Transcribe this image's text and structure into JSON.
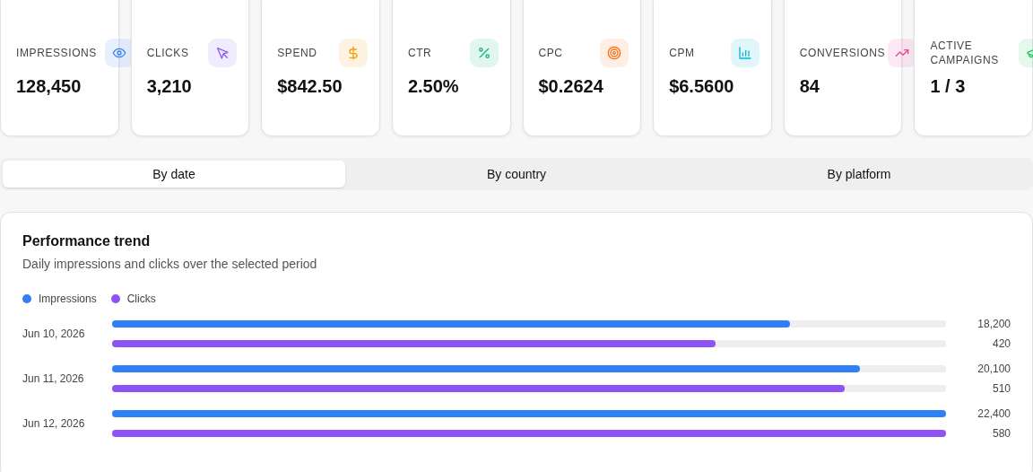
{
  "metrics": [
    {
      "label": "IMPRESSIONS",
      "value": "128,450",
      "color": "#3b82f6"
    },
    {
      "label": "CLICKS",
      "value": "3,210",
      "color": "#8b5cf6"
    },
    {
      "label": "SPEND",
      "value": "$842.50",
      "color": "#f59e0b"
    },
    {
      "label": "CTR",
      "value": "2.50%",
      "color": "#10b981"
    },
    {
      "label": "CPC",
      "value": "$0.2624",
      "color": "#f97316"
    },
    {
      "label": "CPM",
      "value": "$6.5600",
      "color": "#06b6d4"
    },
    {
      "label": "CONVERSIONS",
      "value": "84",
      "color": "#ec4899"
    },
    {
      "label": "ACTIVE CAMPAIGNS",
      "value": "1 / 3",
      "color": "#22c55e"
    }
  ],
  "tabs": [
    {
      "label": "By date",
      "selected": true
    },
    {
      "label": "By country",
      "selected": false
    },
    {
      "label": "By platform",
      "selected": false
    }
  ],
  "panel": {
    "title": "Performance trend",
    "subtitle": "Daily impressions and clicks over the selected period",
    "legend": [
      {
        "label": "Impressions",
        "color": "#2f80f7"
      },
      {
        "label": "Clicks",
        "color": "#8e52f5"
      }
    ],
    "rows": [
      {
        "date": "Jun 10, 2026",
        "bars": [
          {
            "level": 0.8125,
            "reading": "18,200"
          },
          {
            "level": 0.724,
            "reading": "420"
          }
        ]
      },
      {
        "date": "Jun 11, 2026",
        "bars": [
          {
            "level": 0.897,
            "reading": "20,100"
          },
          {
            "level": 0.879,
            "reading": "510"
          }
        ]
      },
      {
        "date": "Jun 12, 2026",
        "bars": [
          {
            "level": 1,
            "reading": "22,400"
          },
          {
            "level": 1,
            "reading": "580"
          }
        ]
      }
    ]
  }
}
